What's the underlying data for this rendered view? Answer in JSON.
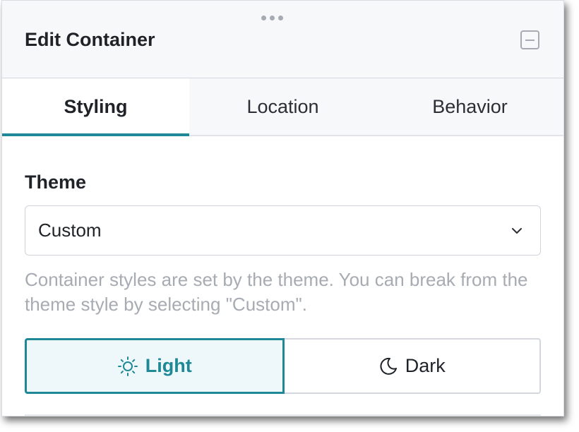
{
  "panel": {
    "title": "Edit Container"
  },
  "tabs": [
    {
      "label": "Styling",
      "active": true
    },
    {
      "label": "Location",
      "active": false
    },
    {
      "label": "Behavior",
      "active": false
    }
  ],
  "theme": {
    "label": "Theme",
    "selected": "Custom",
    "help": "Container styles are set by the theme. You can break from the theme style by selecting \"Custom\"."
  },
  "mode_toggle": {
    "options": [
      {
        "label": "Light",
        "icon": "sun-icon",
        "selected": true
      },
      {
        "label": "Dark",
        "icon": "moon-icon",
        "selected": false
      }
    ]
  },
  "colors": {
    "accent": "#1e8896",
    "accent_bg": "#eef8fa",
    "help_text": "#a7abb2"
  }
}
